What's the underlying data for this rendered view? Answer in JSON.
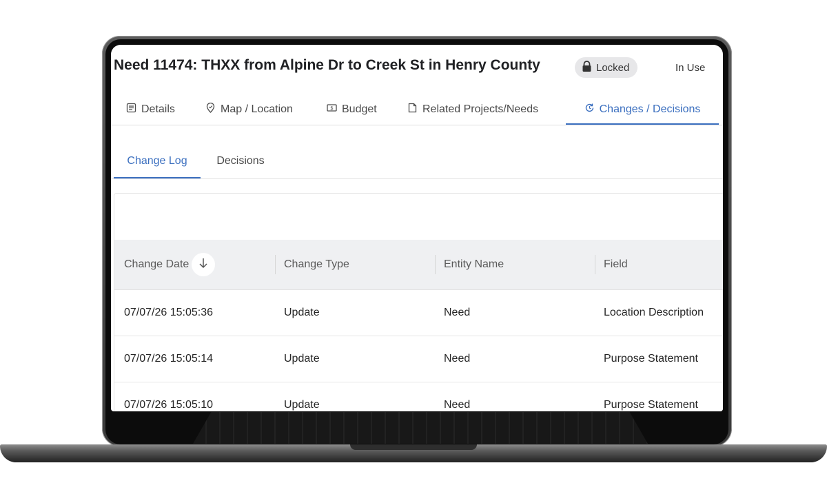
{
  "header": {
    "title": "Need 11474: THXX from Alpine Dr to Creek St in Henry County",
    "lock_label": "Locked",
    "status": "In Use"
  },
  "tabs": [
    {
      "label": "Details",
      "icon": "document-icon"
    },
    {
      "label": "Map / Location",
      "icon": "map-pin-icon"
    },
    {
      "label": "Budget",
      "icon": "dollar-icon"
    },
    {
      "label": "Related Projects/Needs",
      "icon": "file-icon"
    },
    {
      "label": "Changes / Decisions",
      "icon": "history-icon",
      "active": true
    }
  ],
  "subtabs": [
    {
      "label": "Change Log",
      "active": true
    },
    {
      "label": "Decisions"
    }
  ],
  "table": {
    "columns": [
      "Change Date",
      "Change Type",
      "Entity Name",
      "Field"
    ],
    "sort": {
      "column": "Change Date",
      "direction": "descending"
    },
    "rows": [
      [
        "07/07/26 15:05:36",
        "Update",
        "Need",
        "Location Description"
      ],
      [
        "07/07/26 15:05:14",
        "Update",
        "Need",
        "Purpose Statement"
      ],
      [
        "07/07/26 15:05:10",
        "Update",
        "Need",
        "Purpose Statement"
      ]
    ]
  },
  "colors": {
    "accent": "#3b6fbf",
    "header_bg": "#eff0f2",
    "chip_bg": "#e7e7e9"
  }
}
